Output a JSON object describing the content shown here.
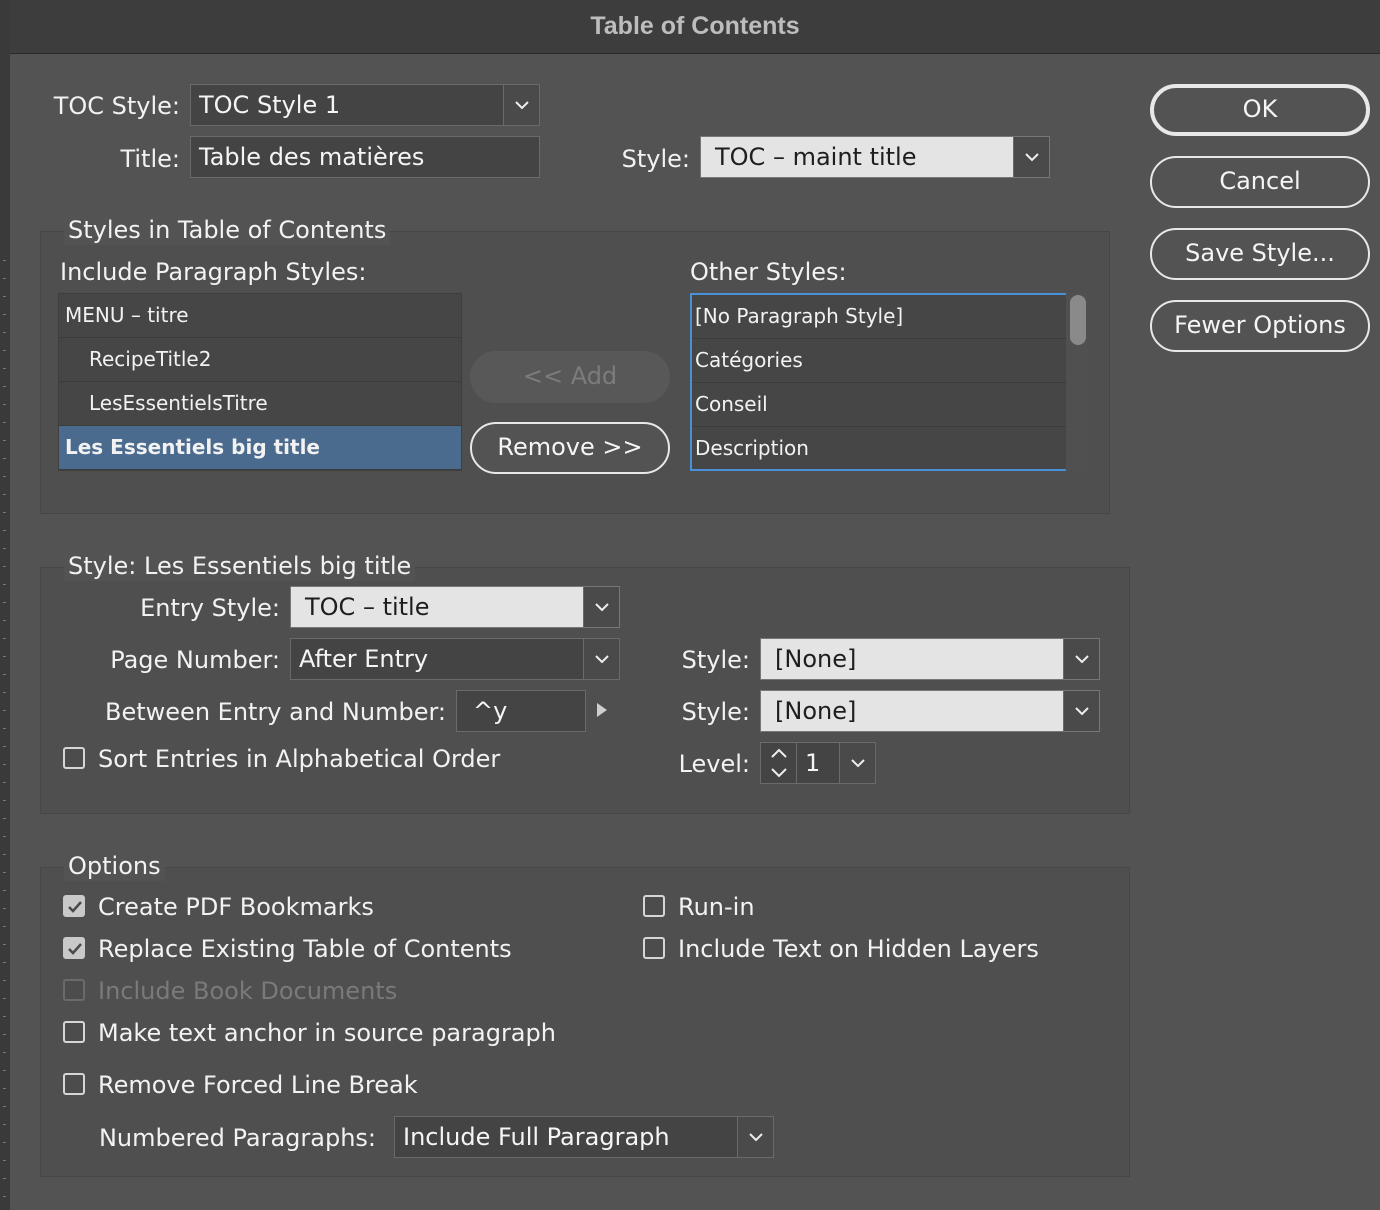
{
  "window": {
    "title": "Table of Contents"
  },
  "toc_style": {
    "label": "TOC Style:",
    "value": "TOC Style 1"
  },
  "title_field": {
    "label": "Title:",
    "value": "Table des matières"
  },
  "title_style": {
    "label": "Style:",
    "value": "TOC – maint title"
  },
  "styles_group": {
    "title": "Styles in Table of Contents",
    "include_label": "Include Paragraph Styles:",
    "include_items": [
      "MENU – titre",
      "RecipeTitle2",
      "LesEssentielsTitre",
      "Les Essentiels big title"
    ],
    "selected_include": "Les Essentiels big title",
    "other_label": "Other Styles:",
    "other_items": [
      "[No Paragraph Style]",
      "Catégories",
      "Conseil",
      "Description"
    ],
    "add_button": "<< Add",
    "remove_button": "Remove >>"
  },
  "entry_group": {
    "title": "Style: Les Essentiels big title",
    "entry_style_label": "Entry Style:",
    "entry_style_value": "TOC – title",
    "page_number_label": "Page Number:",
    "page_number_value": "After Entry",
    "page_number_style_label": "Style:",
    "page_number_style_value": "[None]",
    "between_label": "Between Entry and Number:",
    "between_value": "^y",
    "between_style_label": "Style:",
    "between_style_value": "[None]",
    "sort_label": "Sort Entries in Alphabetical Order",
    "sort_checked": false,
    "level_label": "Level:",
    "level_value": "1"
  },
  "options_group": {
    "title": "Options",
    "create_pdf_bookmarks": {
      "label": "Create PDF Bookmarks",
      "checked": true
    },
    "replace_existing": {
      "label": "Replace Existing Table of Contents",
      "checked": true
    },
    "include_book_documents": {
      "label": "Include Book Documents",
      "checked": false,
      "disabled": true
    },
    "make_text_anchor": {
      "label": "Make text anchor in source paragraph",
      "checked": false
    },
    "remove_forced_line_break": {
      "label": "Remove Forced Line Break",
      "checked": false
    },
    "run_in": {
      "label": "Run-in",
      "checked": false
    },
    "include_hidden_layers": {
      "label": "Include Text on Hidden Layers",
      "checked": false
    },
    "numbered_paragraphs_label": "Numbered Paragraphs:",
    "numbered_paragraphs_value": "Include Full Paragraph"
  },
  "buttons": {
    "ok": "OK",
    "cancel": "Cancel",
    "save_style": "Save Style...",
    "fewer_options": "Fewer Options"
  },
  "icons": {
    "dropdown": "chevron-down-icon",
    "checkmark": "checkmark-icon",
    "stepper": "stepper-icon",
    "insert_menu": "triangle-right-icon"
  },
  "colors": {
    "dialog_bg": "#535353",
    "titlebar_bg": "#3d3d3d",
    "selection": "#4b6b8e",
    "focus": "#4a90d9"
  }
}
